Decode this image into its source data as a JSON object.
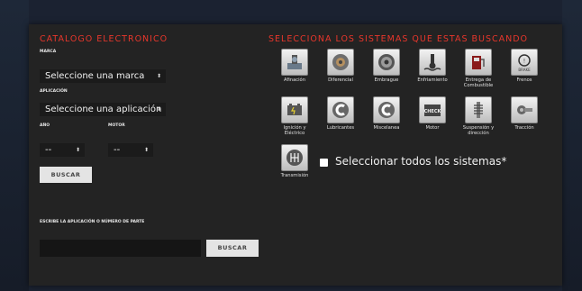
{
  "catalog": {
    "title": "CATALOGO ELECTRONICO",
    "brand_label": "MARCA",
    "brand_value": "Seleccione una marca",
    "application_label": "APLICACIÓN",
    "application_value": "Seleccione una aplicación",
    "year_label": "AÑO",
    "year_value": "--",
    "engine_label": "MOTOR",
    "engine_value": "--",
    "search_label": "BUSCAR"
  },
  "part_search": {
    "label": "ESCRIBE LA APLICACIÓN O NÚMERO DE PARTE",
    "input_value": "",
    "button_label": "BUSCAR"
  },
  "systems": {
    "title": "SELECCIONA LOS SISTEMAS QUE ESTAS BUSCANDO",
    "items": [
      {
        "name": "Afinación",
        "icon": "spark-plug-icon"
      },
      {
        "name": "Diferencial",
        "icon": "differential-gear-icon"
      },
      {
        "name": "Embrague",
        "icon": "clutch-plate-icon"
      },
      {
        "name": "Enfriamiento",
        "icon": "coolant-temperature-icon"
      },
      {
        "name": "Entrega de Combustible",
        "icon": "fuel-pump-icon"
      },
      {
        "name": "Frenos",
        "icon": "brake-warning-icon"
      },
      {
        "name": "Ignición y Eléctrico",
        "icon": "battery-icon"
      },
      {
        "name": "Lubricantes",
        "icon": "lubricant-c-icon"
      },
      {
        "name": "Miscelanea",
        "icon": "misc-c-icon"
      },
      {
        "name": "Motor",
        "icon": "check-engine-icon"
      },
      {
        "name": "Suspensión y dirección",
        "icon": "shock-absorber-icon"
      },
      {
        "name": "Tracción",
        "icon": "cv-joint-icon"
      },
      {
        "name": "Transmisión",
        "icon": "gear-shift-icon"
      }
    ],
    "brake_icon_text": "BRAKE",
    "engine_icon_text": "CHECK",
    "select_all_label": "Seleccionar todos los sistemas*"
  },
  "colors": {
    "accent_red": "#e7362b",
    "panel_bg": "#232323",
    "page_bg": "#1b2231"
  }
}
